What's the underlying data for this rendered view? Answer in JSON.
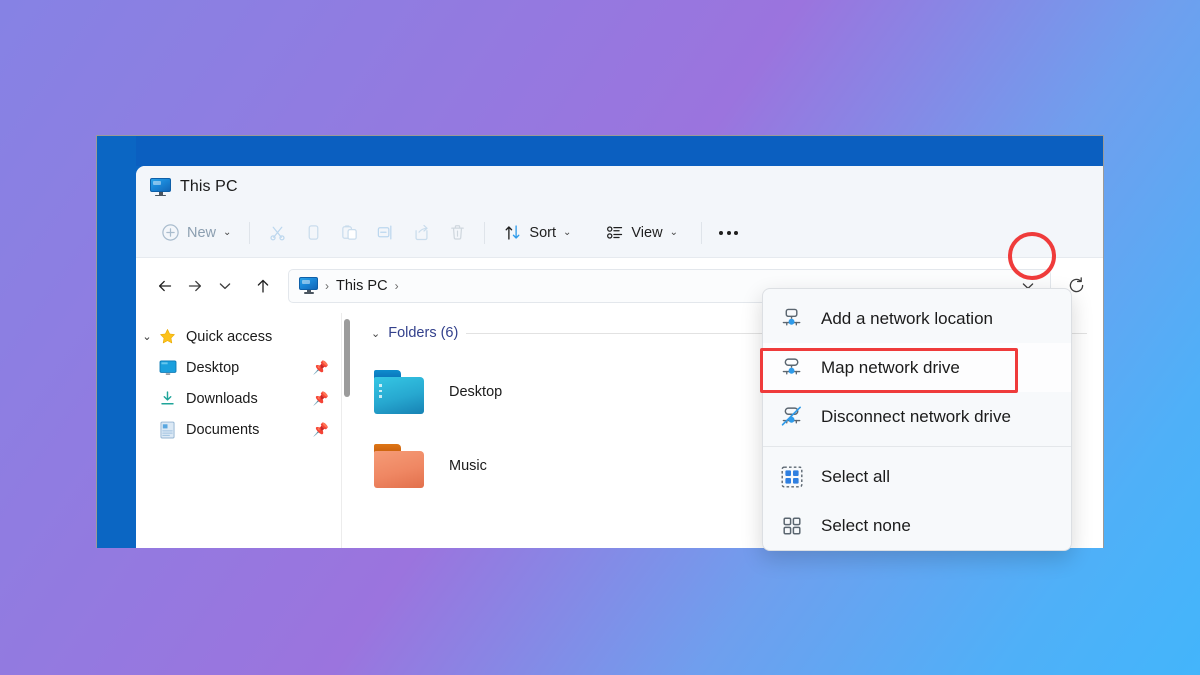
{
  "window": {
    "tab_title": "This PC",
    "tab_icon": "this-pc-monitor-icon",
    "frame_color": "#0b66c3",
    "titlebar_color": "#0b5fc0"
  },
  "toolbar": {
    "new_label": "New",
    "new_icon": "plus-circle-icon",
    "sort_label": "Sort",
    "sort_icon": "sort-arrows-icon",
    "view_label": "View",
    "view_icon": "view-list-icon",
    "more_icon": "ellipsis-icon",
    "chevron": "⌄",
    "actions": [
      {
        "name": "cut",
        "icon": "scissors-icon",
        "enabled": false
      },
      {
        "name": "copy",
        "icon": "copy-icon",
        "enabled": false
      },
      {
        "name": "paste",
        "icon": "paste-icon",
        "enabled": false
      },
      {
        "name": "rename",
        "icon": "rename-icon",
        "enabled": false
      },
      {
        "name": "share",
        "icon": "share-icon",
        "enabled": false
      },
      {
        "name": "delete",
        "icon": "trash-icon",
        "enabled": false
      }
    ]
  },
  "address_bar": {
    "back_icon": "arrow-left-icon",
    "forward_icon": "arrow-right-icon",
    "recent_icon": "chevron-down-icon",
    "up_icon": "arrow-up-icon",
    "path_icon": "this-pc-monitor-icon",
    "crumb": "This PC",
    "separator": "›",
    "dropdown_icon": "chevron-down-icon",
    "refresh_icon": "refresh-icon"
  },
  "nav_pane": {
    "groups": [
      {
        "label": "Quick access",
        "icon": "star-icon",
        "caret": "⌄",
        "expanded": true,
        "items": [
          {
            "label": "Desktop",
            "icon": "desktop-icon",
            "pinned": true
          },
          {
            "label": "Downloads",
            "icon": "downloads-icon",
            "pinned": true
          },
          {
            "label": "Documents",
            "icon": "documents-icon",
            "pinned": true
          }
        ]
      }
    ],
    "pin_glyph": "📌"
  },
  "content": {
    "group_label": "Folders (6)",
    "group_caret": "⌄",
    "items": [
      {
        "label": "Desktop",
        "icon": "folder-icon",
        "color_top": "#0a7bc4",
        "color_body": "#29b8d8"
      },
      {
        "label": "Music",
        "icon": "folder-icon",
        "color_top": "#d2690f",
        "color_body": "#f08a63"
      }
    ]
  },
  "context_menu": {
    "groups": [
      {
        "items": [
          {
            "label": "Add a network location",
            "icon": "add-network-location-icon",
            "highlighted": false
          },
          {
            "label": "Map network drive",
            "icon": "map-network-drive-icon",
            "highlighted": true
          },
          {
            "label": "Disconnect network drive",
            "icon": "disconnect-network-drive-icon",
            "highlighted": false
          }
        ]
      },
      {
        "items": [
          {
            "label": "Select all",
            "icon": "select-all-icon",
            "highlighted": false
          },
          {
            "label": "Select none",
            "icon": "select-none-icon",
            "highlighted": false
          }
        ]
      }
    ]
  },
  "annotations": {
    "highlight_color": "#ef3b3b",
    "more_button_circle": "ellipsis-button-highlight",
    "map_drive_box": "map-network-drive-highlight"
  }
}
